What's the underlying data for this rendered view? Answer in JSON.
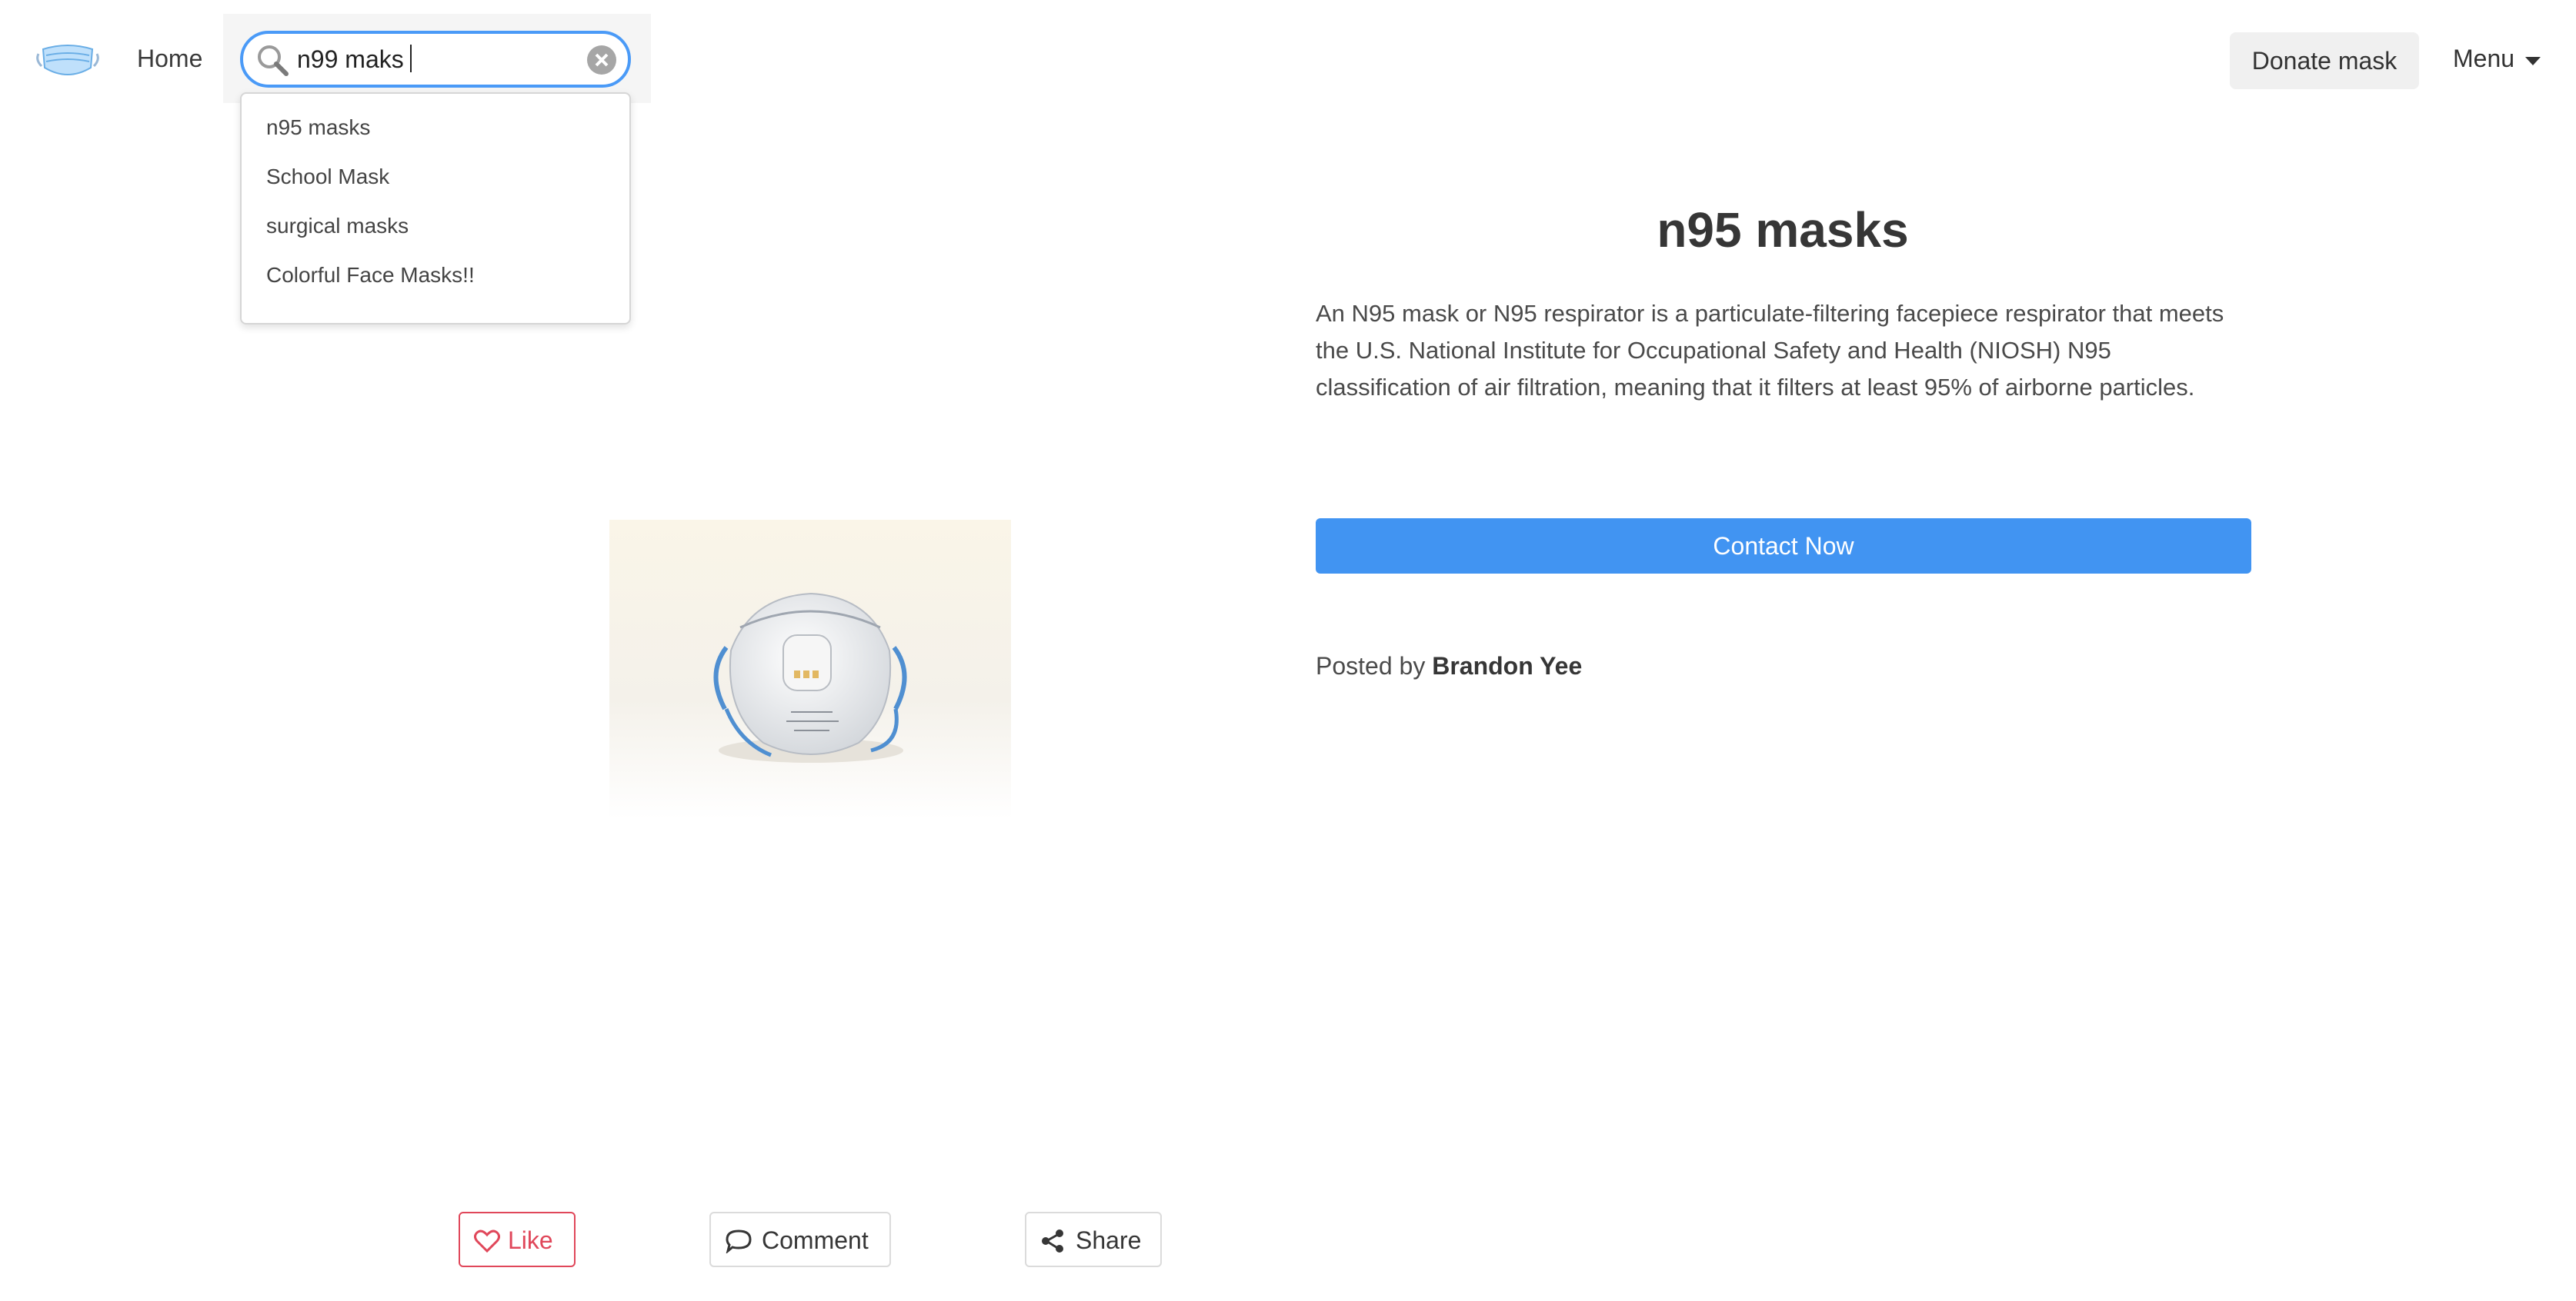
{
  "nav": {
    "home_label": "Home",
    "donate_label": "Donate mask",
    "menu_label": "Menu"
  },
  "search": {
    "value": "n99 maks",
    "suggestions": [
      "n95 masks",
      "School Mask",
      "surgical masks",
      "Colorful Face Masks!!"
    ]
  },
  "product": {
    "title": "n95 masks",
    "description": "An N95 mask or N95 respirator is a particulate-filtering facepiece respirator that meets the U.S. National Institute for Occupational Safety and Health (NIOSH) N95 classification of air filtration, meaning that it filters at least 95% of airborne particles.",
    "contact_label": "Contact Now",
    "posted_prefix": "Posted by",
    "author": "Brandon Yee"
  },
  "actions": {
    "like_label": "Like",
    "comment_label": "Comment",
    "share_label": "Share"
  },
  "colors": {
    "accent": "#4194f2",
    "like": "#e0475a",
    "search_border": "#4a9af7"
  },
  "icons": [
    "mask-logo-icon",
    "search-icon",
    "clear-icon",
    "chevron-down-icon",
    "heart-icon",
    "comment-icon",
    "share-icon"
  ]
}
